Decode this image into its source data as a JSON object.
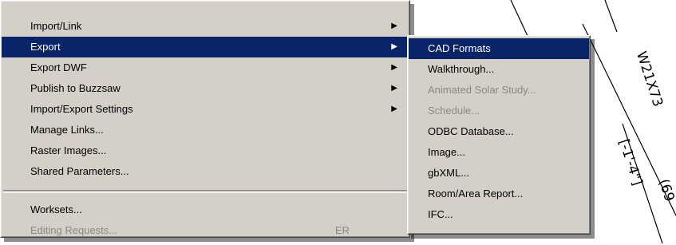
{
  "file_menu": {
    "items": [
      {
        "label": "Import/Link",
        "submenu": true
      },
      {
        "label": "Export",
        "submenu": true,
        "selected": true
      },
      {
        "label": "Export DWF",
        "submenu": true
      },
      {
        "label": "Publish to Buzzsaw",
        "submenu": true
      },
      {
        "label": "Import/Export Settings",
        "submenu": true
      },
      {
        "label": "Manage Links..."
      },
      {
        "label": "Raster Images..."
      },
      {
        "label": "Shared Parameters..."
      },
      {
        "label": "Worksets..."
      },
      {
        "label": "Editing Requests...",
        "disabled": true,
        "accelerator": "ER"
      }
    ],
    "submenu_arrow_icon": "triangle-right-icon"
  },
  "export_submenu": {
    "items": [
      {
        "label": "CAD Formats",
        "selected": true
      },
      {
        "label": "Walkthrough..."
      },
      {
        "label": "Animated Solar Study...",
        "disabled": true
      },
      {
        "label": "Schedule...",
        "disabled": true
      },
      {
        "label": "ODBC Database..."
      },
      {
        "label": "Image..."
      },
      {
        "label": "gbXML..."
      },
      {
        "label": "Room/Area Report..."
      },
      {
        "label": "IFC..."
      }
    ]
  },
  "drawing": {
    "beam_label": "W21X73",
    "offset_label": "[-1'-4\"]",
    "partial_label": "(69"
  },
  "colors": {
    "menu_face": "#d4d0c8",
    "highlight": "#0a246a",
    "highlight_text": "#ffffff",
    "disabled_text": "#8a8880"
  }
}
